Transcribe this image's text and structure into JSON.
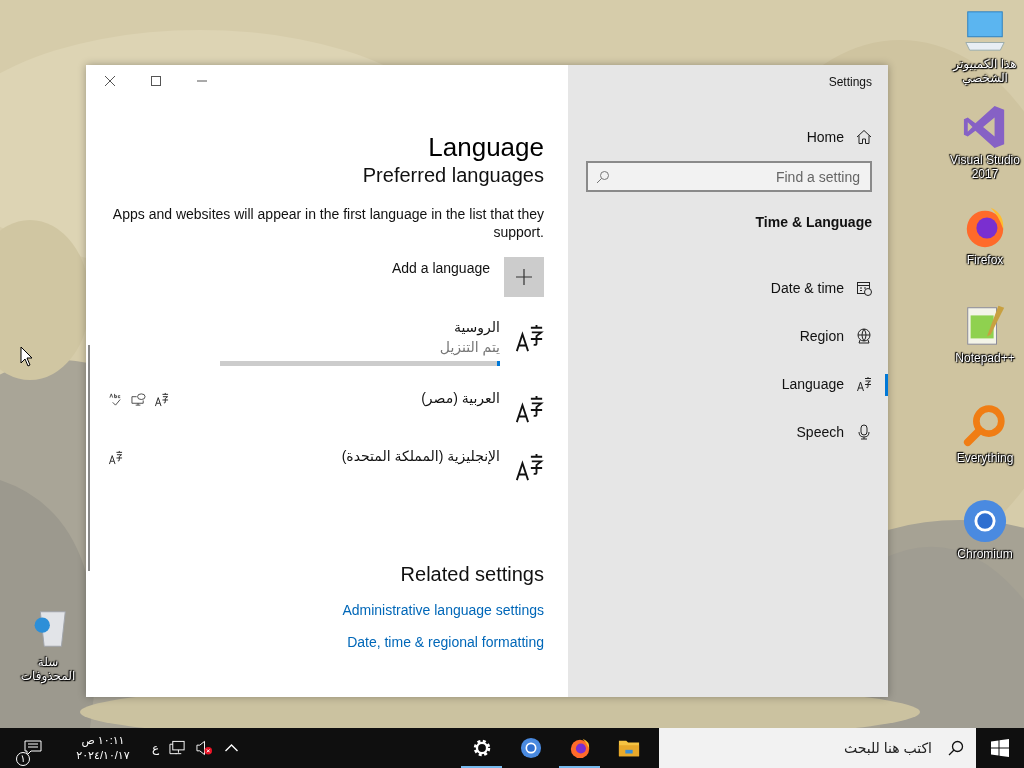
{
  "desktop_icons": [
    {
      "label": "هذا الكمبيوتر الشخصي",
      "kind": "computer"
    },
    {
      "label": "Visual Studio 2017",
      "kind": "visualstudio"
    },
    {
      "label": "Firefox",
      "kind": "firefox"
    },
    {
      "label": "Notepad++",
      "kind": "notepad"
    },
    {
      "label": "Everything",
      "kind": "everything"
    },
    {
      "label": "Chromium",
      "kind": "chromium"
    },
    {
      "label": "سلة المحذوفات",
      "kind": "recycle"
    }
  ],
  "window": {
    "title": "Settings"
  },
  "content": {
    "title": "Language",
    "subtitle": "Preferred languages",
    "description": "Apps and websites will appear in the first language in the list that they support.",
    "add_language": "Add a language",
    "languages": [
      {
        "name": "الروسية",
        "status": "يتم التنزيل",
        "level": 0.01
      },
      {
        "name": "العربية (مصر)",
        "features": [
          {
            "kind": "spelling"
          },
          {
            "kind": "speech"
          },
          {
            "kind": "display"
          }
        ]
      },
      {
        "name": "الإنجليزية (المملكة المتحدة)",
        "features": [
          {
            "kind": "display"
          }
        ]
      }
    ],
    "related": {
      "title": "Related settings",
      "links": [
        "Administrative language settings",
        "Date, time & regional formatting"
      ]
    }
  },
  "sidebar": {
    "home": "Home",
    "search": {
      "placeholder": "Find a setting"
    },
    "section": "Time & Language",
    "items": [
      {
        "label": "Date & time",
        "kind": "calendar",
        "selected": false
      },
      {
        "label": "Region",
        "kind": "globe",
        "selected": false
      },
      {
        "label": "Language",
        "kind": "language",
        "selected": true
      },
      {
        "label": "Speech",
        "kind": "microphone",
        "selected": false
      }
    ]
  },
  "taskbar": {
    "search": {
      "placeholder": "اكتب هنا للبحث"
    },
    "apps": [
      {
        "kind": "settings",
        "running": true
      },
      {
        "kind": "chromium",
        "running": false
      },
      {
        "kind": "firefox",
        "running": true
      },
      {
        "kind": "folder",
        "running": false
      }
    ],
    "keyboard": "ع",
    "time": "١٠:١١ ص",
    "date": "٢٠٢٤/١٠/١٧",
    "notifications": "١"
  }
}
